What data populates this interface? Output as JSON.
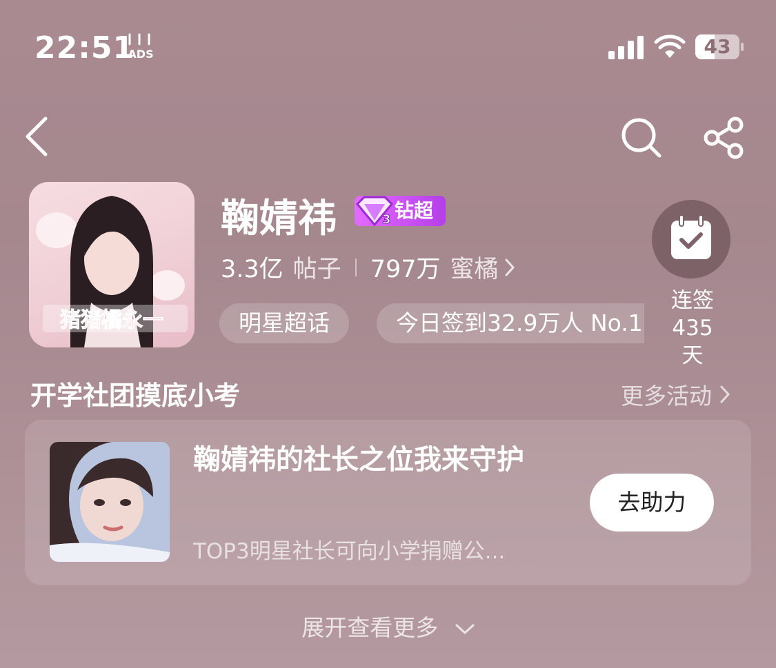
{
  "status_bar": {
    "time": "22:51",
    "ads_label": "ADS",
    "battery_level_percent": 43,
    "battery_text": "43"
  },
  "nav": {
    "back_icon": "chevron-left-icon",
    "search_icon": "search-icon",
    "share_icon": "share-icon"
  },
  "profile": {
    "name": "鞠婧祎",
    "tier_level": "3",
    "tier_label": "钻超",
    "posts_count": "3.3亿",
    "posts_unit": "帖子",
    "fans_count": "797万",
    "fans_unit": "蜜橘",
    "avatar_caption": "猪猪橘永一",
    "tags": [
      "明星超话",
      "今日签到32.9万人 No.1"
    ]
  },
  "signin": {
    "label_line1": "连签",
    "label_line2": "435天",
    "icon": "calendar-check-icon"
  },
  "section": {
    "title": "开学社团摸底小考",
    "more_label": "更多活动"
  },
  "card": {
    "title": "鞠婧祎的社长之位我来守护",
    "subtitle": "TOP3明星社长可向小学捐赠公...",
    "button_label": "去助力"
  },
  "expand": {
    "label": "展开查看更多"
  },
  "colors": {
    "background": "#a98a91",
    "badge_gradient_start": "#e46bff",
    "badge_gradient_end": "#b43fe8",
    "signin_circle": "#7d6268"
  }
}
